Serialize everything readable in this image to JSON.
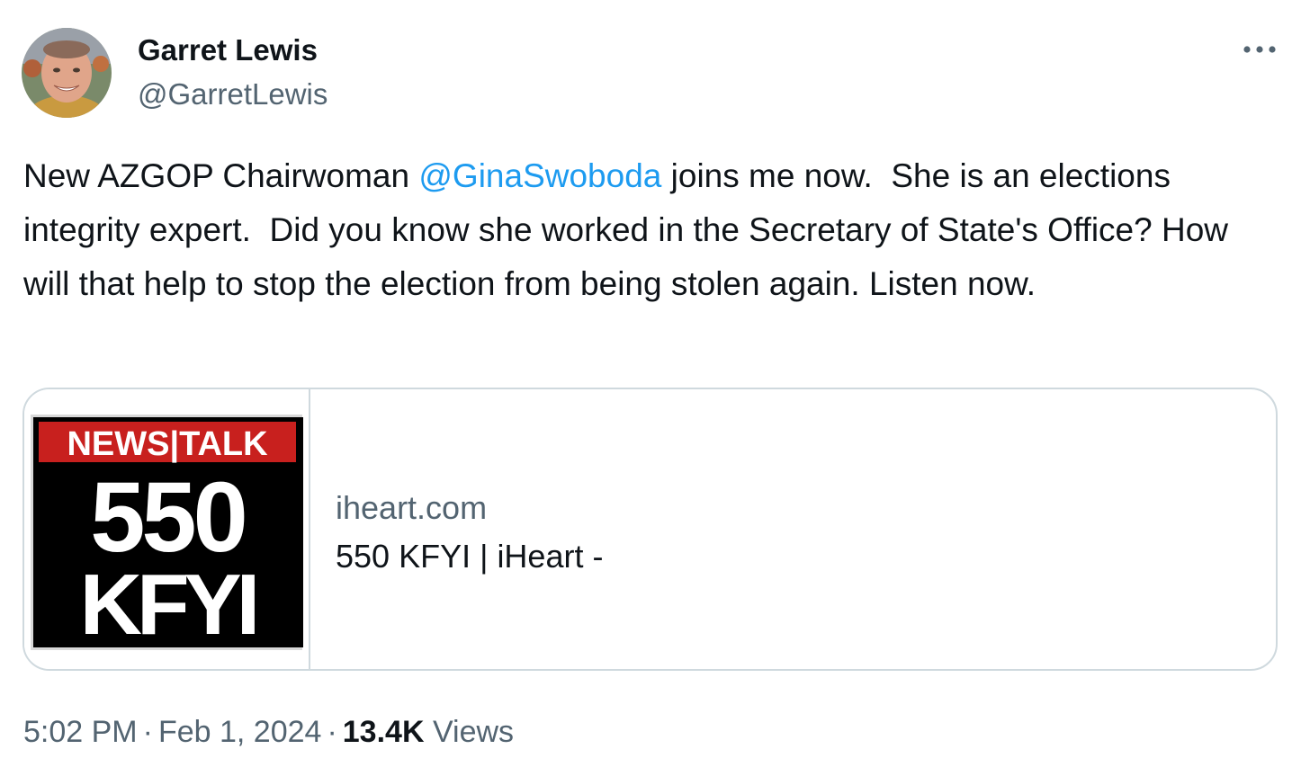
{
  "author": {
    "display_name": "Garret Lewis",
    "handle": "@GarretLewis"
  },
  "tweet": {
    "text_before": "New AZGOP Chairwoman ",
    "mention": "@GinaSwoboda",
    "text_after": " joins me now.  She is an elections integrity expert.  Did you know she worked in the Secretary of State's Office? How will that help to stop the election from being stolen again. Listen now."
  },
  "card": {
    "domain": "iheart.com",
    "title": "550 KFYI | iHeart -",
    "logo": {
      "top_text": "NEWS|TALK",
      "number": "550",
      "call_sign": "KFYI"
    }
  },
  "meta": {
    "time": "5:02 PM",
    "date": "Feb 1, 2024",
    "views_count": "13.4K",
    "views_label": "Views",
    "separator": "·"
  },
  "icons": {
    "more": "more-options-icon"
  },
  "colors": {
    "accent": "#1d9bf0",
    "text": "#0f1419",
    "secondary": "#536471",
    "border": "#cfd9de",
    "logo_red": "#c8201e",
    "logo_black": "#000000"
  }
}
